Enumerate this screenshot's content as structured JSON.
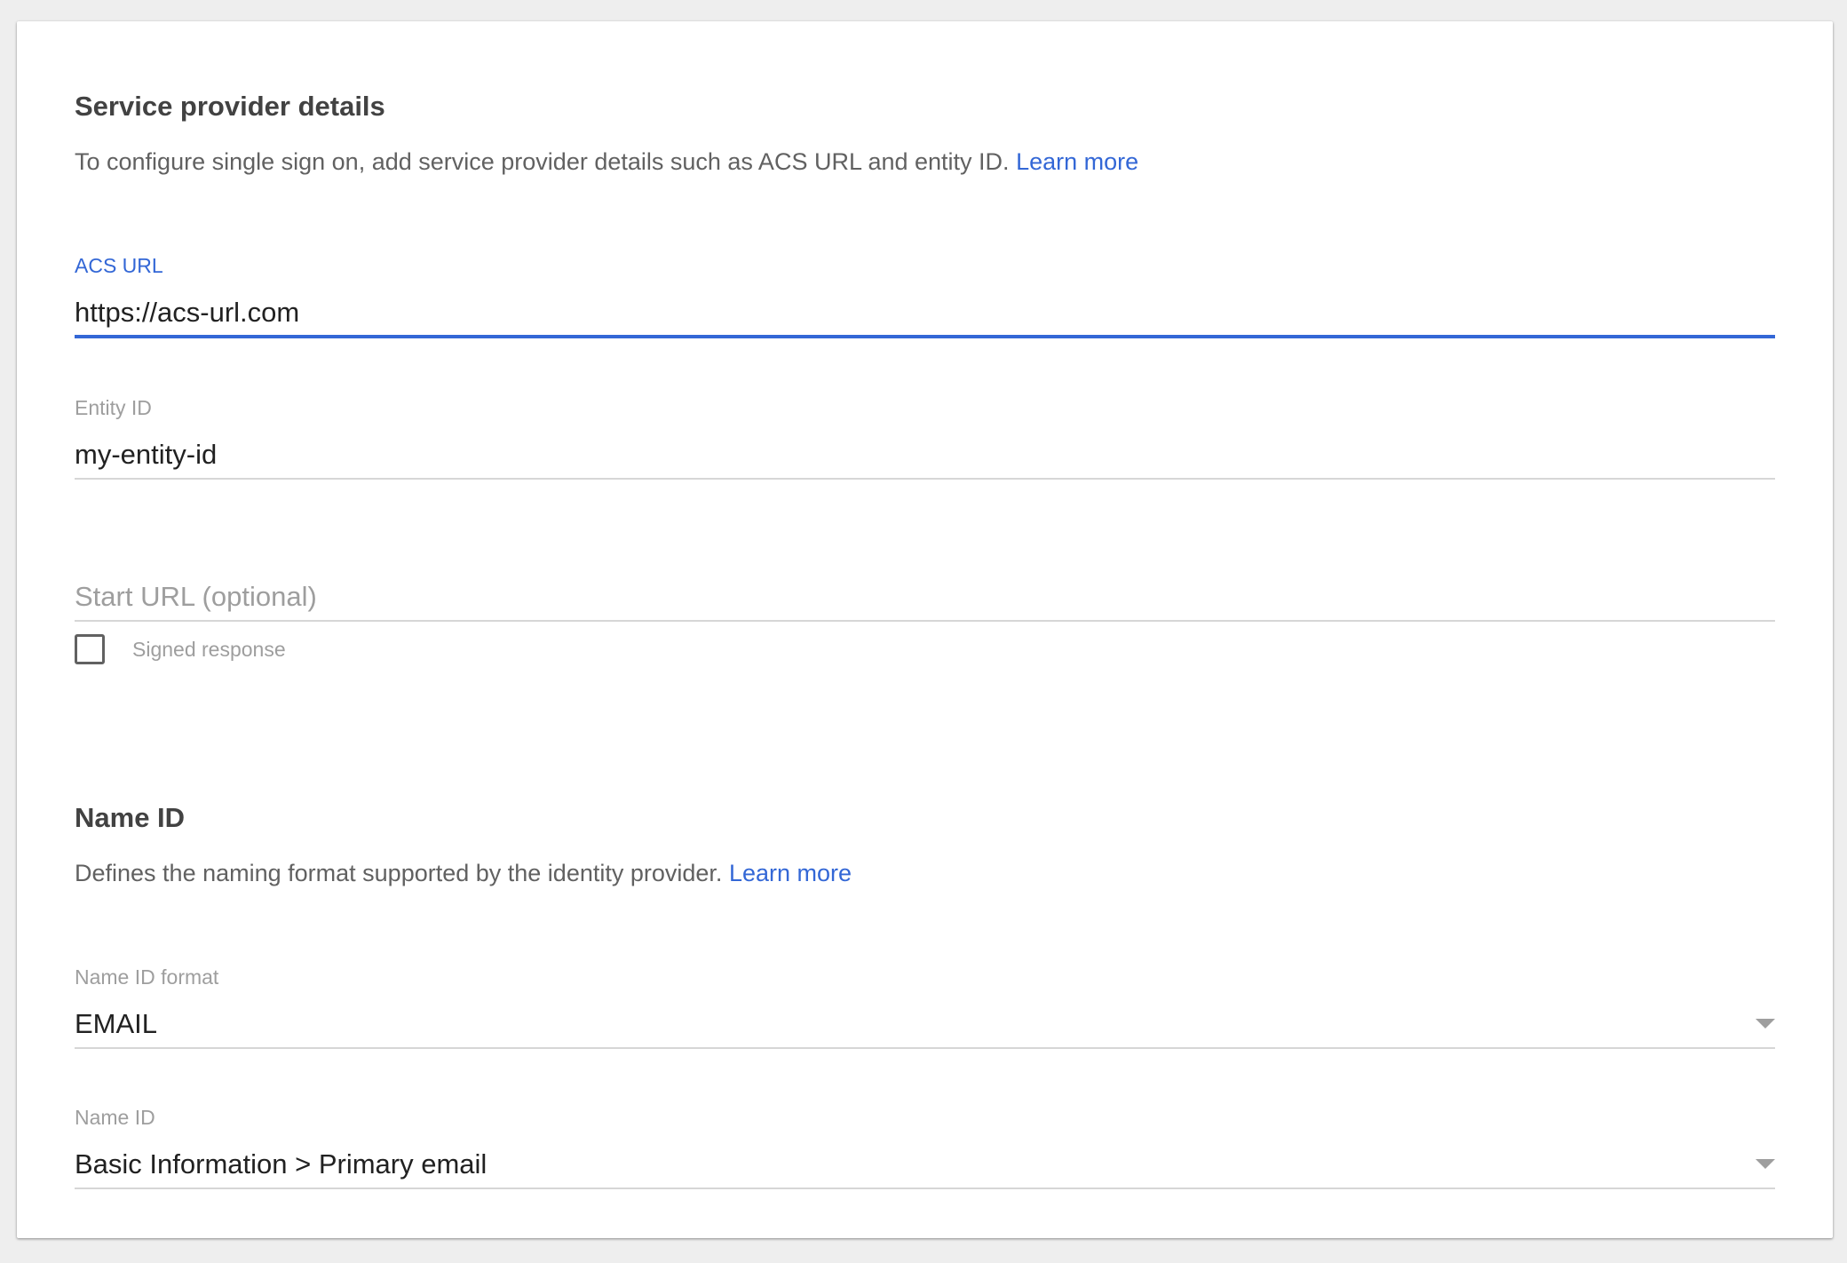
{
  "service_provider": {
    "title": "Service provider details",
    "description": "To configure single sign on, add service provider details such as ACS URL and entity ID.",
    "learn_more": "Learn more"
  },
  "acs_url": {
    "label": "ACS URL",
    "value": "https://acs-url.com"
  },
  "entity_id": {
    "label": "Entity ID",
    "value": "my-entity-id"
  },
  "start_url": {
    "placeholder": "Start URL (optional)",
    "value": ""
  },
  "signed_response": {
    "label": "Signed response",
    "checked": false
  },
  "name_id_section": {
    "title": "Name ID",
    "description": "Defines the naming format supported by the identity provider.",
    "learn_more": "Learn more"
  },
  "name_id_format": {
    "label": "Name ID format",
    "selected": "EMAIL"
  },
  "name_id": {
    "label": "Name ID",
    "selected": "Basic Information > Primary email"
  },
  "colors": {
    "accent": "#3367d6",
    "label_gray": "#9e9e9e",
    "text": "#212121",
    "divider": "#d6d6d6"
  }
}
